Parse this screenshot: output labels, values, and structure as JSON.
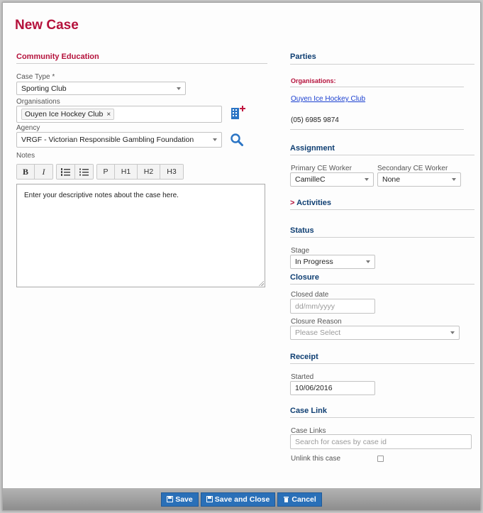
{
  "page": {
    "title": "New Case"
  },
  "community_education": {
    "section_title": "Community Education",
    "case_type": {
      "label": "Case Type *",
      "value": "Sporting Club"
    },
    "organisations": {
      "label": "Organisations",
      "tag": "Ouyen Ice Hockey Club",
      "remove": "×"
    },
    "agency": {
      "label": "Agency",
      "value": "VRGF - Victorian Responsible Gambling Foundation"
    },
    "notes": {
      "label": "Notes",
      "text": "Enter your descriptive notes about the case here.",
      "toolbar": {
        "bold": "B",
        "italic": "I",
        "p": "P",
        "h1": "H1",
        "h2": "H2",
        "h3": "H3"
      }
    }
  },
  "parties": {
    "section_title": "Parties",
    "organisations_label": "Organisations:",
    "org_link": "Ouyen Ice Hockey Club",
    "phone": "(05) 6985 9874"
  },
  "assignment": {
    "section_title": "Assignment",
    "primary": {
      "label": "Primary CE Worker",
      "value": "CamilleC"
    },
    "secondary": {
      "label": "Secondary CE Worker",
      "value": "None"
    }
  },
  "activities": {
    "section_title": "Activities",
    "chevron": ">"
  },
  "status": {
    "section_title": "Status",
    "stage": {
      "label": "Stage",
      "value": "In Progress"
    }
  },
  "closure": {
    "section_title": "Closure",
    "closed_date": {
      "label": "Closed date",
      "placeholder": "dd/mm/yyyy"
    },
    "reason": {
      "label": "Closure Reason",
      "placeholder": "Please Select"
    }
  },
  "receipt": {
    "section_title": "Receipt",
    "started": {
      "label": "Started",
      "value": "10/06/2016"
    }
  },
  "case_link": {
    "section_title": "Case Link",
    "links_label": "Case Links",
    "search_placeholder": "Search for cases by case id",
    "unlink_label": "Unlink this case"
  },
  "footer": {
    "save": "Save",
    "save_close": "Save and Close",
    "cancel": "Cancel"
  },
  "colors": {
    "accent": "#b5123c",
    "button": "#2a70b8",
    "icon": "#2a74c4",
    "add": "#c0163f"
  },
  "icons": {
    "add_org": "building-add-icon",
    "search": "search-icon",
    "save": "floppy-icon",
    "cancel": "trash-icon"
  }
}
